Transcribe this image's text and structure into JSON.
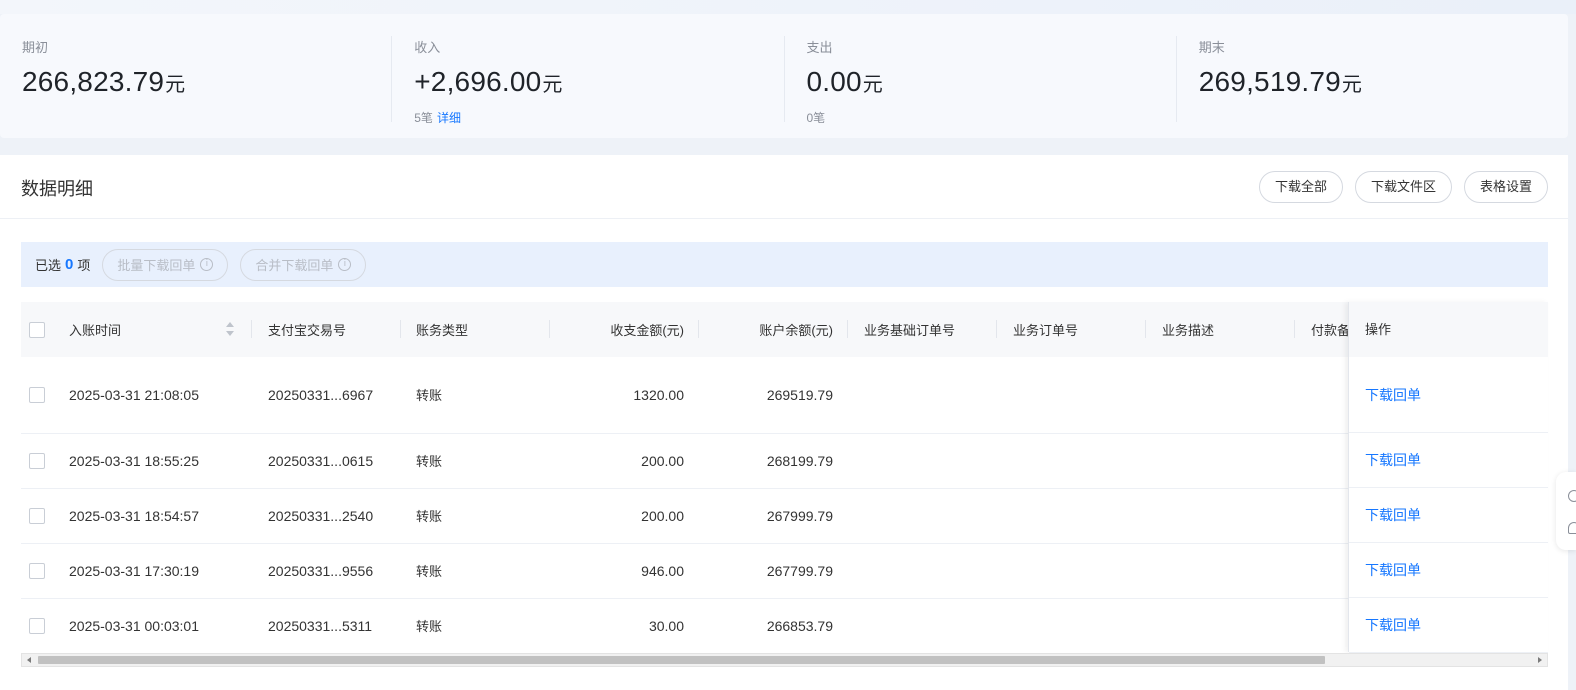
{
  "summary": [
    {
      "label": "期初",
      "value": "266,823.79",
      "unit": "元",
      "count": "",
      "detail": ""
    },
    {
      "label": "收入",
      "value": "+2,696.00",
      "unit": "元",
      "count": "5笔",
      "detail": "详细"
    },
    {
      "label": "支出",
      "value": "0.00",
      "unit": "元",
      "count": "0笔",
      "detail": ""
    },
    {
      "label": "期末",
      "value": "269,519.79",
      "unit": "元",
      "count": "",
      "detail": ""
    }
  ],
  "panel": {
    "title": "数据明细",
    "actions": [
      "下载全部",
      "下载文件区",
      "表格设置"
    ]
  },
  "selection": {
    "prefix": "已选",
    "count": "0",
    "suffix": "项",
    "batch_download": "批量下载回单",
    "merge_download": "合并下载回单",
    "info_glyph": "i"
  },
  "table": {
    "columns": [
      "入账时间",
      "支付宝交易号",
      "账务类型",
      "收支金额(元)",
      "账户余额(元)",
      "业务基础订单号",
      "业务订单号",
      "业务描述",
      "付款备注"
    ],
    "action_column": "操作",
    "rows": [
      {
        "time": "2025-03-31 21:08:05",
        "trade_no": "20250331...6967",
        "type": "转账",
        "amount": "1320.00",
        "balance": "269519.79",
        "base_order": "",
        "order": "",
        "desc": "",
        "remark": "",
        "action": "下载回单"
      },
      {
        "time": "2025-03-31 18:55:25",
        "trade_no": "20250331...0615",
        "type": "转账",
        "amount": "200.00",
        "balance": "268199.79",
        "base_order": "",
        "order": "",
        "desc": "",
        "remark": "",
        "action": "下载回单"
      },
      {
        "time": "2025-03-31 18:54:57",
        "trade_no": "20250331...2540",
        "type": "转账",
        "amount": "200.00",
        "balance": "267999.79",
        "base_order": "",
        "order": "",
        "desc": "",
        "remark": "",
        "action": "下载回单"
      },
      {
        "time": "2025-03-31 17:30:19",
        "trade_no": "20250331...9556",
        "type": "转账",
        "amount": "946.00",
        "balance": "267799.79",
        "base_order": "",
        "order": "",
        "desc": "",
        "remark": "",
        "action": "下载回单"
      },
      {
        "time": "2025-03-31 00:03:01",
        "trade_no": "20250331...5311",
        "type": "转账",
        "amount": "30.00",
        "balance": "266853.79",
        "base_order": "",
        "order": "",
        "desc": "",
        "remark": "",
        "action": "下载回单"
      }
    ]
  },
  "colors": {
    "accent": "#1677ff",
    "selection_bar": "#e8f0fd"
  },
  "icons": [
    "info-icon",
    "sort-icon",
    "scroll-left-arrow-icon",
    "scroll-right-arrow-icon",
    "help-icon",
    "headset-icon"
  ]
}
